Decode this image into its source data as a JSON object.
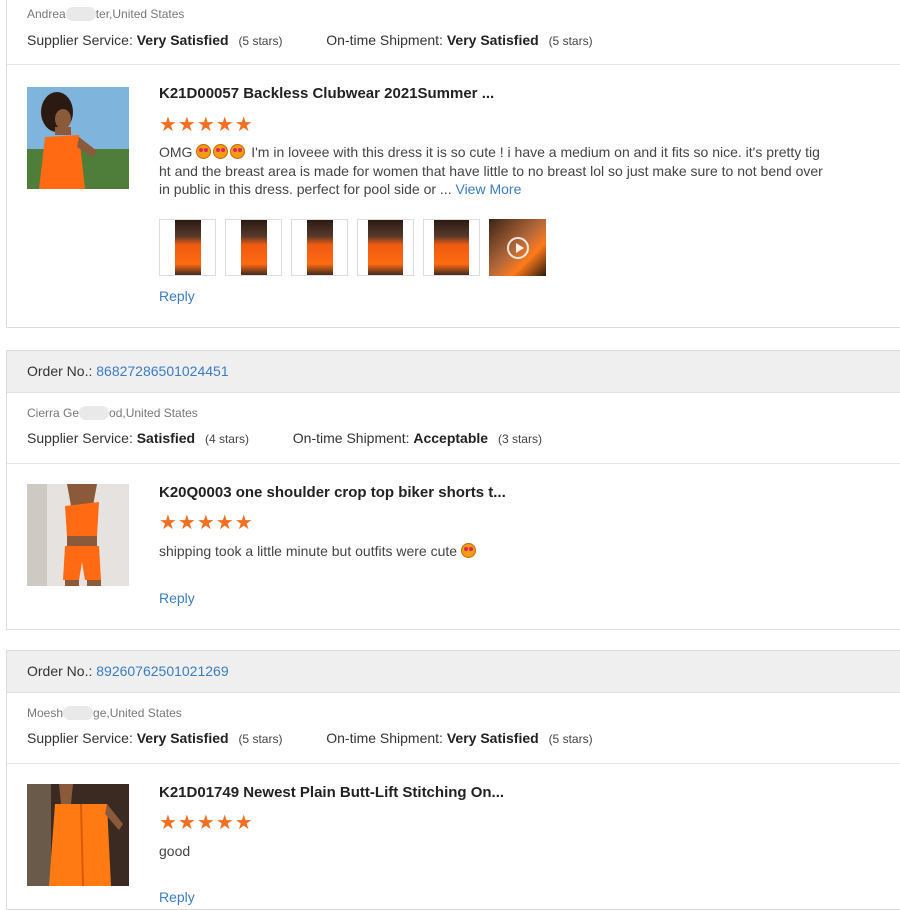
{
  "reviews": [
    {
      "order_label": "",
      "order_number": "",
      "buyer_prefix": "Andrea",
      "buyer_suffix": "ter,United States",
      "supplier_label": "Supplier Service:",
      "supplier_value": "Very Satisfied",
      "supplier_stars": "(5 stars)",
      "shipment_label": "On-time Shipment:",
      "shipment_value": "Very Satisfied",
      "shipment_stars": "(5 stars)",
      "product_title": "K21D00057 Backless Clubwear 2021Summer ...",
      "rating": "★★★★★",
      "review_start": "OMG",
      "review_text": " I'm in loveee with this dress it is so cute ! i have a medium on and it fits so nice. it's pretty tight and the breast area is made for women that have little to no breast lol so just make sure to not bend over in public in this dress. perfect for pool side or ... ",
      "view_more": "View More",
      "reply": "Reply"
    },
    {
      "order_label": "Order No.:",
      "order_number": "86827286501024451",
      "buyer_prefix": "Cierra Ge",
      "buyer_suffix": "od,United States",
      "supplier_label": "Supplier Service:",
      "supplier_value": "Satisfied",
      "supplier_stars": "(4 stars)",
      "shipment_label": "On-time Shipment:",
      "shipment_value": "Acceptable",
      "shipment_stars": "(3 stars)",
      "product_title": "K20Q0003 one shoulder crop top biker shorts t...",
      "rating": "★★★★★",
      "review_text": "shipping took a little minute but outfits were cute ",
      "reply": "Reply"
    },
    {
      "order_label": "Order No.:",
      "order_number": "89260762501021269",
      "buyer_prefix": "Moesh",
      "buyer_suffix": "ge,United States",
      "supplier_label": "Supplier Service:",
      "supplier_value": "Very Satisfied",
      "supplier_stars": "(5 stars)",
      "shipment_label": "On-time Shipment:",
      "shipment_value": "Very Satisfied",
      "shipment_stars": "(5 stars)",
      "product_title": "K21D01749 Newest Plain Butt-Lift Stitching On...",
      "rating": "★★★★★",
      "review_text": "good",
      "reply": "Reply"
    }
  ],
  "colors": {
    "accent_orange": "#f36f21",
    "link_blue": "#3a7cc0",
    "order_bar_bg": "#efefef"
  }
}
